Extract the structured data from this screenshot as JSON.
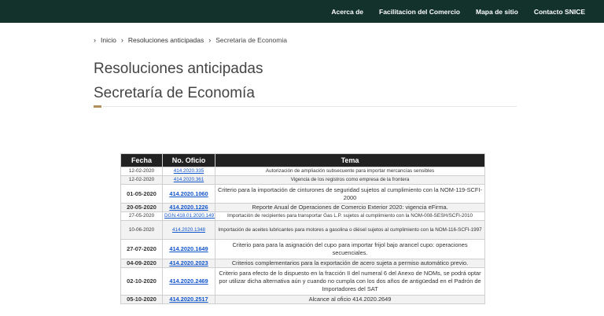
{
  "nav": {
    "links": [
      "Acerca de",
      "Facilitacion del Comercio",
      "Mapa de sitio",
      "Contacto SNICE"
    ]
  },
  "breadcrumb": {
    "items": [
      "Inicio",
      "Resoluciones anticipadas"
    ],
    "current": "Secretaria de Economia"
  },
  "page": {
    "title": "Resoluciones anticipadas",
    "subtitle": "Secretaría de Economía"
  },
  "table": {
    "headers": [
      "Fecha",
      "No. Oficio",
      "Tema"
    ],
    "rows": [
      {
        "fecha": "12-02-2020",
        "oficio": "414.2020.335",
        "tema": "Autorización de ampliación subsecuente para importar mercancías sensibles",
        "size": "small",
        "height": 11
      },
      {
        "fecha": "12-02-2020",
        "oficio": "414.2020.361",
        "tema": "Vigencia de los registros como empresa de la frontera",
        "size": "small",
        "height": 11
      },
      {
        "fecha": "01-05-2020",
        "oficio": "414.2020.1060",
        "tema": "Criterio para la importación de cinturones de seguridad sujetos al cumplimiento con la NOM-119-SCFI-2000",
        "size": "big",
        "height": 24
      },
      {
        "fecha": "20-05-2020",
        "oficio": "414.2020.1226",
        "tema": "Reporte Anual de Operaciones de Comercio Exterior 2020: vigencia eFirma.",
        "size": "big",
        "height": 11
      },
      {
        "fecha": "27-05-2020",
        "oficio": "DGN.418.01.2020.1497",
        "tema": "Importación de recipientes para transportar Gas L.P. sujetos al cumplimiento con la NOM-008-SESH/SCFI-2010",
        "size": "small",
        "height": 11
      },
      {
        "fecha": "10-06-2020",
        "oficio": "414.2020.1348",
        "tema": "Importación de aceites lubricantes para motores a gasolina o diésel sujetos al cumplimiento con la NOM-116-SCFI-1997",
        "size": "small",
        "height": 24
      },
      {
        "fecha": "27-07-2020",
        "oficio": "414.2020.1649",
        "tema": "Criterio para para la asignación del cupo para importar frijol bajo arancel cupo: operaciones secuenciales.",
        "size": "big",
        "height": 25
      },
      {
        "fecha": "04-09-2020",
        "oficio": "414.2020.2023",
        "tema": "Criterios complementarios para la exportación de acero sujeta a permiso automático previo.",
        "size": "big",
        "height": 11
      },
      {
        "fecha": "02-10-2020",
        "oficio": "414.2020.2469",
        "tema": "Criterio para efecto de lo dispuesto en la fracción II del numeral 6 del Anexo de NOMs, se podrá optar por utilizar dicha alternativa aún y cuando no cumpla con los dos años de antigüedad en el Padrón de Importadores del SAT",
        "size": "big",
        "height": 35
      },
      {
        "fecha": "05-10-2020",
        "oficio": "414.2020.2517",
        "tema": "Alcance al oficio 414.2020.2649",
        "size": "big",
        "height": 11
      }
    ]
  }
}
